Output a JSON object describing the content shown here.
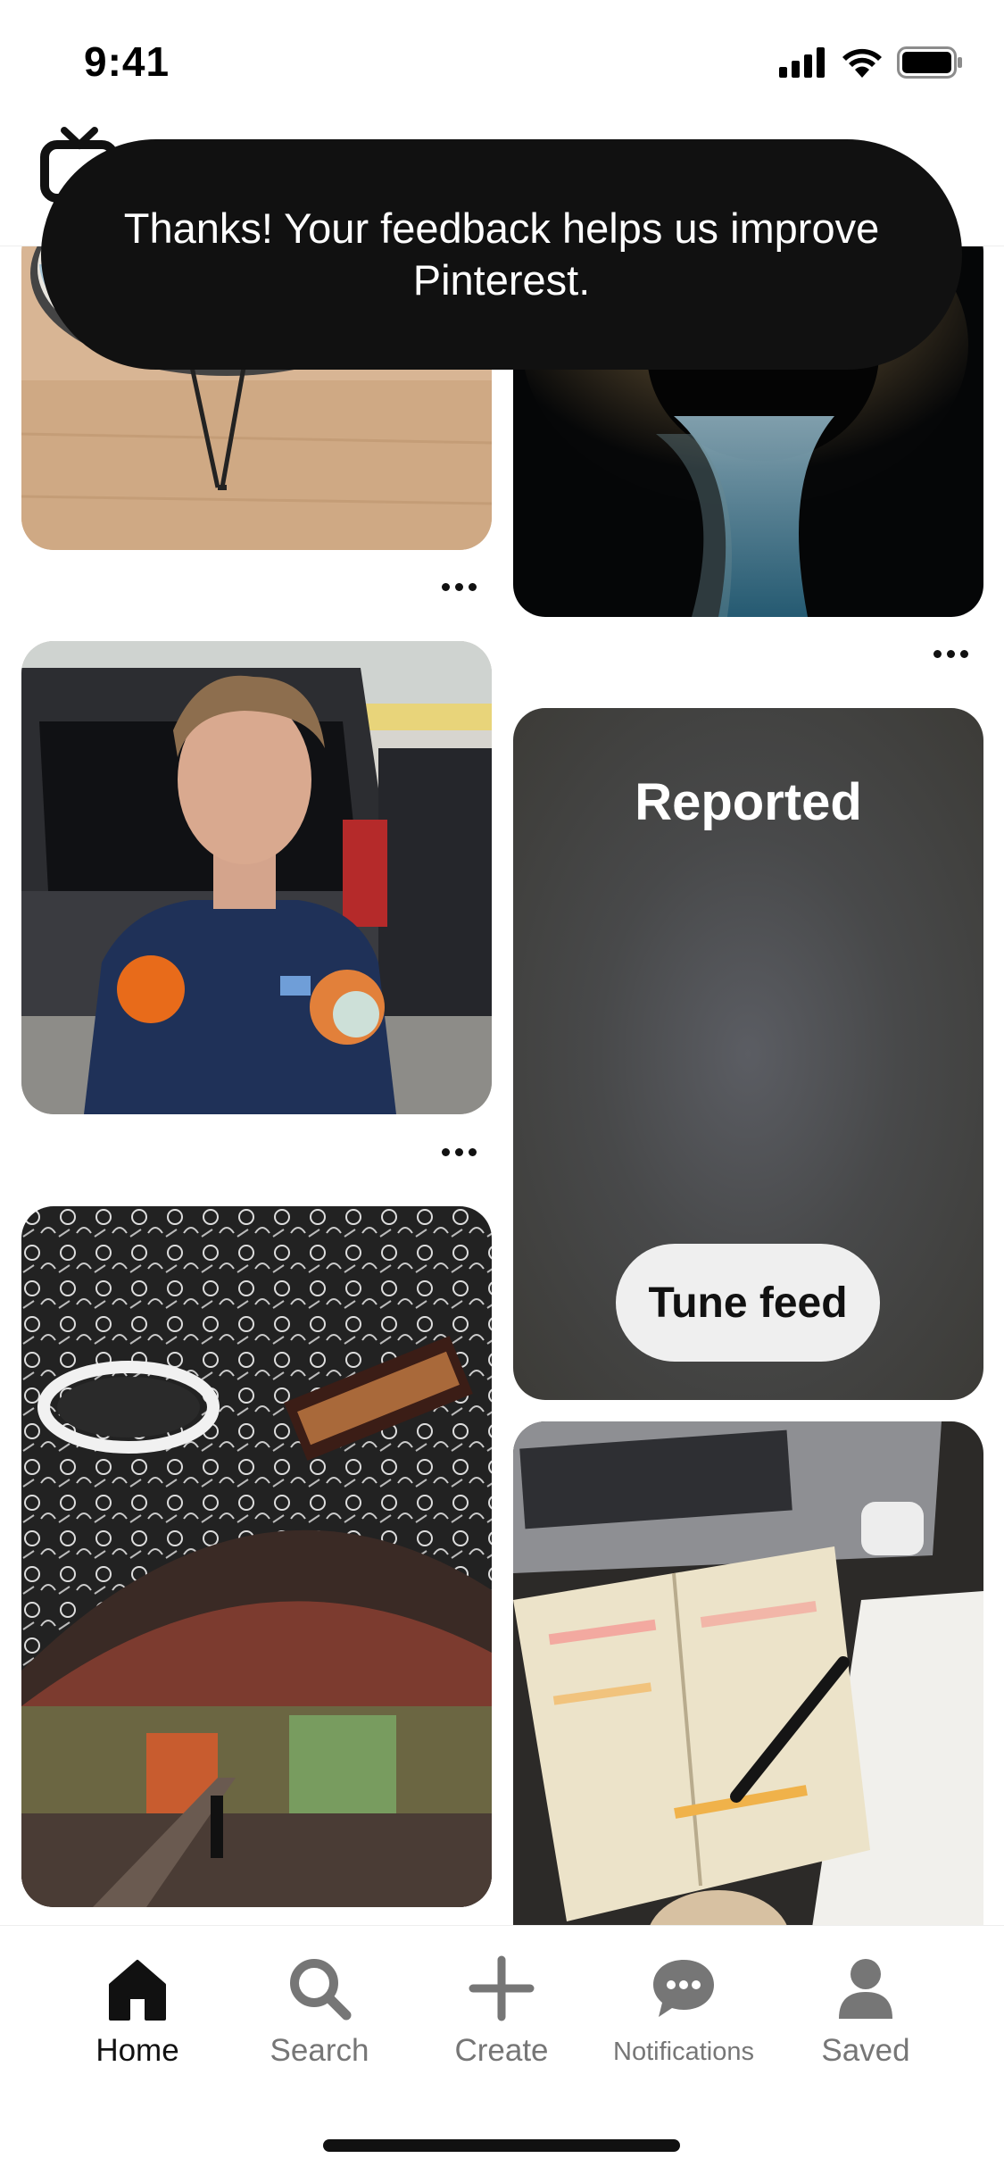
{
  "status_bar": {
    "time": "9:41",
    "icons": [
      "cellular-signal-icon",
      "wifi-icon",
      "battery-icon"
    ]
  },
  "header": {
    "icon": "tv-icon"
  },
  "toast": {
    "message": "Thanks! Your feedback helps us improve Pinterest."
  },
  "feed": {
    "pins": [
      {
        "id": "pin-table",
        "image": "round-glass-table-on-hairpin-legs"
      },
      {
        "id": "pin-blackhole",
        "image": "black-hole-space-art"
      },
      {
        "id": "pin-man-oranges",
        "image": "man-holding-two-oranges-by-car"
      },
      {
        "id": "pin-graffiti-tunnel",
        "image": "graffiti-tunnel-the-vaults"
      },
      {
        "id": "pin-bible-study",
        "image": "open-bible-with-highlights-and-laptop"
      }
    ],
    "reported_card": {
      "title": "Reported",
      "button_label": "Tune feed"
    }
  },
  "bottom_nav": {
    "items": [
      {
        "label": "Home",
        "icon": "home-icon",
        "active": true
      },
      {
        "label": "Search",
        "icon": "search-icon",
        "active": false
      },
      {
        "label": "Create",
        "icon": "plus-icon",
        "active": false
      },
      {
        "label": "Notifications",
        "icon": "chat-bubble-icon",
        "active": false
      },
      {
        "label": "Saved",
        "icon": "profile-icon",
        "active": false
      }
    ]
  },
  "colors": {
    "toast_bg": "#111111",
    "reported_bg": "#48494a",
    "active_nav": "#111111",
    "inactive_nav": "#767676"
  }
}
